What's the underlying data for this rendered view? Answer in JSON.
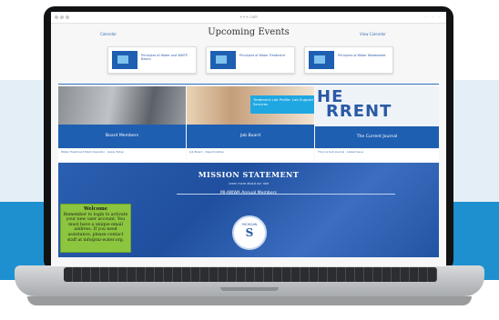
{
  "page": {
    "title": "Upcoming Events",
    "url": "+++.com",
    "toolbar_glyphs": "◦ ◦ ◦"
  },
  "links": {
    "left": "Calendar",
    "right": "View Calendar"
  },
  "events": [
    {
      "text": "Principles of Water and WWTP Basics"
    },
    {
      "text": "Principles of Water Treatment"
    },
    {
      "text": "Principles of Water Wastewater"
    }
  ],
  "tiles": [
    {
      "label": "Board Members"
    },
    {
      "label": "Job Board",
      "overlay": "Treatment Lab Profile: Lab Support Services"
    },
    {
      "label": "The Current Journal",
      "logo": [
        "HE",
        "RRENT"
      ]
    }
  ],
  "strips": [
    {
      "text": "Water Treatment Plant Operator · Apply Today"
    },
    {
      "text": "Job Board · Opportunities"
    },
    {
      "text": "The Current Journal · Latest Issue"
    }
  ],
  "mission": {
    "title": "MISSION STATEMENT",
    "subtitle": "Learn more about our role",
    "link": "MI-AWWA Annual Members",
    "logo_top": "MICHIGAN",
    "logo_letter": "S"
  },
  "welcome": {
    "heading": "Welcome",
    "body": "Remember to login to activate your new user account. You must have a unique email address. If you need assistance, please contact staff at info@mi-water.org."
  },
  "colors": {
    "brand_blue": "#1f5fb2",
    "accent_green": "#8cc63f",
    "background_blue": "#1e90cf"
  }
}
